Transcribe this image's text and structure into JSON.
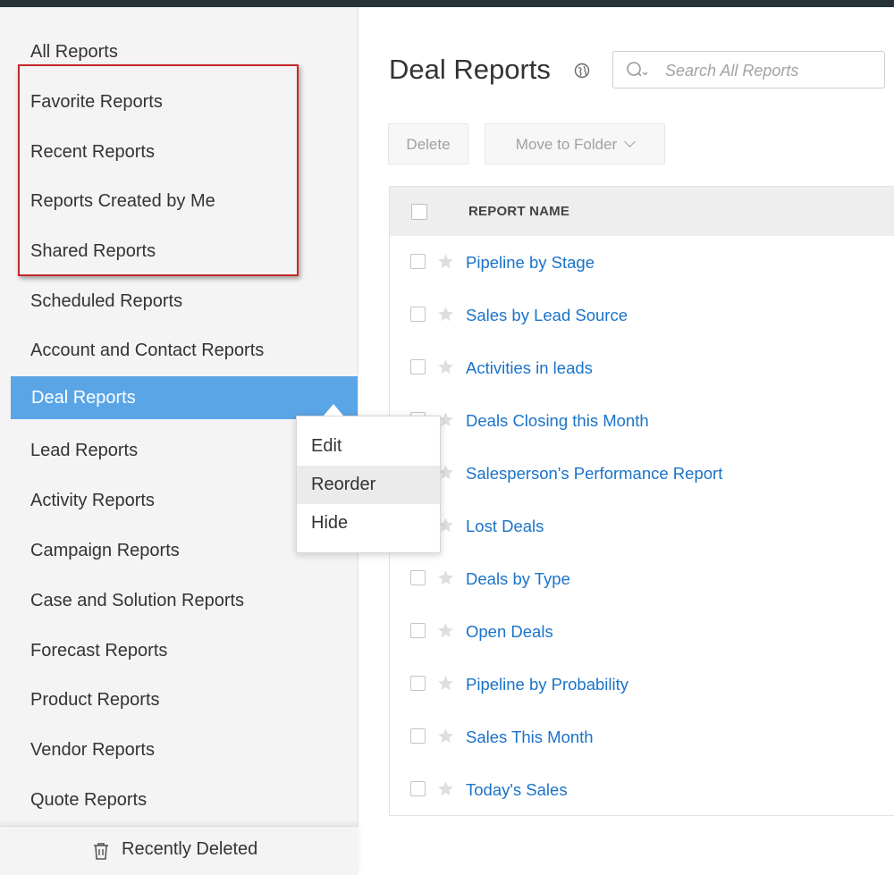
{
  "sidebar": {
    "items": [
      {
        "label": "All Reports"
      },
      {
        "label": "Favorite Reports"
      },
      {
        "label": "Recent Reports"
      },
      {
        "label": "Reports Created by Me"
      },
      {
        "label": "Shared Reports"
      },
      {
        "label": "Scheduled Reports"
      },
      {
        "label": "Account and Contact Reports"
      },
      {
        "label": "Deal Reports",
        "active": true
      },
      {
        "label": "Lead Reports"
      },
      {
        "label": "Activity Reports"
      },
      {
        "label": "Campaign Reports"
      },
      {
        "label": "Case and Solution Reports"
      },
      {
        "label": "Forecast Reports"
      },
      {
        "label": "Product Reports"
      },
      {
        "label": "Vendor Reports"
      },
      {
        "label": "Quote Reports"
      }
    ],
    "footer": {
      "label": "Recently Deleted",
      "icon": "trash-icon"
    }
  },
  "context_menu": {
    "items": [
      {
        "label": "Edit"
      },
      {
        "label": "Reorder"
      },
      {
        "label": "Hide"
      }
    ]
  },
  "main": {
    "title": "Deal Reports",
    "title_icon": "globe-icon",
    "search": {
      "placeholder": "Search All Reports"
    },
    "toolbar": {
      "delete_label": "Delete",
      "move_label": "Move to Folder"
    },
    "table": {
      "header": "REPORT NAME",
      "rows": [
        {
          "name": "Pipeline by Stage"
        },
        {
          "name": "Sales by Lead Source"
        },
        {
          "name": "Activities in leads"
        },
        {
          "name": "Deals Closing this Month"
        },
        {
          "name": "Salesperson's Performance Report"
        },
        {
          "name": "Lost Deals"
        },
        {
          "name": "Deals by Type"
        },
        {
          "name": "Open Deals"
        },
        {
          "name": "Pipeline by Probability"
        },
        {
          "name": "Sales This Month"
        },
        {
          "name": "Today's Sales"
        }
      ]
    }
  },
  "colors": {
    "active": "#5aa5e6",
    "link": "#1a73c9",
    "highlight_border": "#c62828",
    "topbar": "#263238"
  }
}
